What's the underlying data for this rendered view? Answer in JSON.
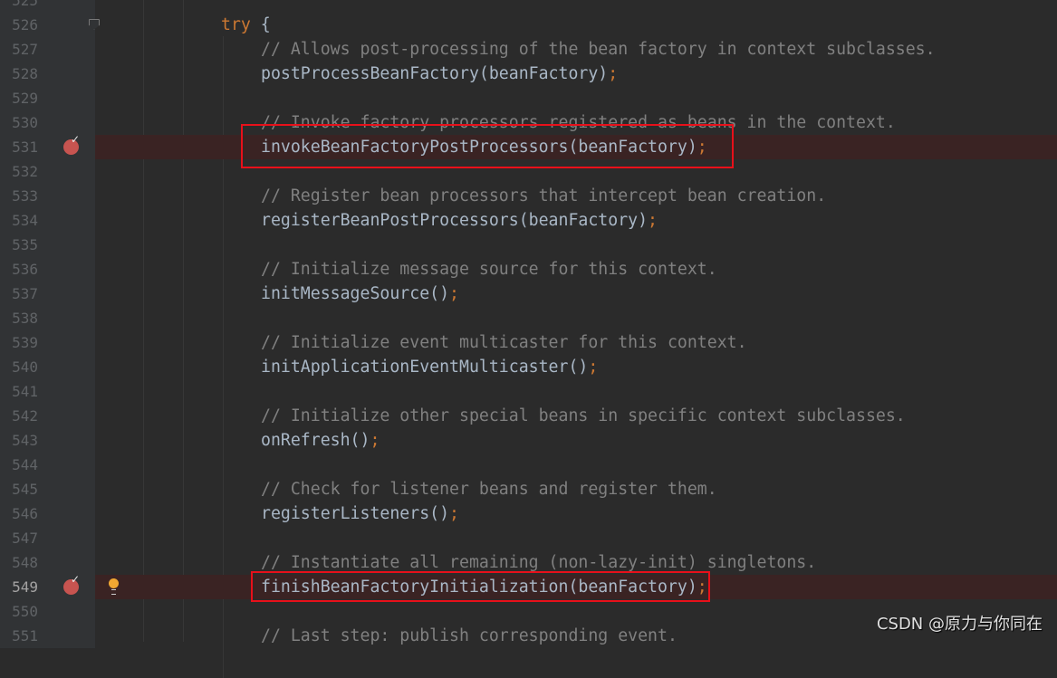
{
  "editor": {
    "lines": [
      {
        "number": "525",
        "indent": 0,
        "segments": []
      },
      {
        "number": "526",
        "indent": 1,
        "fold": true,
        "segments": [
          {
            "t": "try",
            "c": "kw"
          },
          {
            "t": " {",
            "c": ""
          }
        ]
      },
      {
        "number": "527",
        "indent": 2,
        "segments": [
          {
            "t": "// Allows post-processing of the bean factory in context subclasses.",
            "c": "cmt"
          }
        ]
      },
      {
        "number": "528",
        "indent": 2,
        "segments": [
          {
            "t": "postProcessBeanFactory(beanFactory)",
            "c": ""
          },
          {
            "t": ";",
            "c": "pn"
          }
        ]
      },
      {
        "number": "529",
        "indent": 0,
        "segments": []
      },
      {
        "number": "530",
        "indent": 2,
        "segments": [
          {
            "t": "// Invoke factory processors registered as beans in the context.",
            "c": "cmt"
          }
        ]
      },
      {
        "number": "531",
        "indent": 2,
        "breakpoint": true,
        "highlighted": true,
        "segments": [
          {
            "t": "invokeBeanFactoryPostProcessors(beanFactory)",
            "c": ""
          },
          {
            "t": ";",
            "c": "pn"
          }
        ]
      },
      {
        "number": "532",
        "indent": 0,
        "segments": []
      },
      {
        "number": "533",
        "indent": 2,
        "segments": [
          {
            "t": "// Register bean processors that intercept bean creation.",
            "c": "cmt"
          }
        ]
      },
      {
        "number": "534",
        "indent": 2,
        "segments": [
          {
            "t": "registerBeanPostProcessors(beanFactory)",
            "c": ""
          },
          {
            "t": ";",
            "c": "pn"
          }
        ]
      },
      {
        "number": "535",
        "indent": 0,
        "segments": []
      },
      {
        "number": "536",
        "indent": 2,
        "segments": [
          {
            "t": "// Initialize message source for this context.",
            "c": "cmt"
          }
        ]
      },
      {
        "number": "537",
        "indent": 2,
        "segments": [
          {
            "t": "initMessageSource()",
            "c": ""
          },
          {
            "t": ";",
            "c": "pn"
          }
        ]
      },
      {
        "number": "538",
        "indent": 0,
        "segments": []
      },
      {
        "number": "539",
        "indent": 2,
        "segments": [
          {
            "t": "// Initialize event multicaster for this context.",
            "c": "cmt"
          }
        ]
      },
      {
        "number": "540",
        "indent": 2,
        "segments": [
          {
            "t": "initApplicationEventMulticaster()",
            "c": ""
          },
          {
            "t": ";",
            "c": "pn"
          }
        ]
      },
      {
        "number": "541",
        "indent": 0,
        "segments": []
      },
      {
        "number": "542",
        "indent": 2,
        "segments": [
          {
            "t": "// Initialize other special beans in specific context subclasses.",
            "c": "cmt"
          }
        ]
      },
      {
        "number": "543",
        "indent": 2,
        "segments": [
          {
            "t": "onRefresh()",
            "c": ""
          },
          {
            "t": ";",
            "c": "pn"
          }
        ]
      },
      {
        "number": "544",
        "indent": 0,
        "segments": []
      },
      {
        "number": "545",
        "indent": 2,
        "segments": [
          {
            "t": "// Check for listener beans and register them.",
            "c": "cmt"
          }
        ]
      },
      {
        "number": "546",
        "indent": 2,
        "segments": [
          {
            "t": "registerListeners()",
            "c": ""
          },
          {
            "t": ";",
            "c": "pn"
          }
        ]
      },
      {
        "number": "547",
        "indent": 0,
        "segments": []
      },
      {
        "number": "548",
        "indent": 2,
        "segments": [
          {
            "t": "// Instantiate all remaining (non-lazy-init) singletons.",
            "c": "cmt"
          }
        ]
      },
      {
        "number": "549",
        "indent": 2,
        "breakpoint": true,
        "bulb": true,
        "current": true,
        "highlighted": true,
        "segments": [
          {
            "t": "finishBeanFactoryInitialization(beanFactory)",
            "c": ""
          },
          {
            "t": ";",
            "c": "pn"
          }
        ]
      },
      {
        "number": "550",
        "indent": 0,
        "segments": []
      },
      {
        "number": "551",
        "indent": 2,
        "segments": [
          {
            "t": "// Last step: publish corresponding event.",
            "c": "cmt"
          }
        ]
      }
    ]
  },
  "colors": {
    "highlight_box": "#e8101a",
    "breakpoint": "#c75450",
    "keyword": "#cc7832",
    "comment": "#808080"
  },
  "watermark": "CSDN @原力与你同在"
}
